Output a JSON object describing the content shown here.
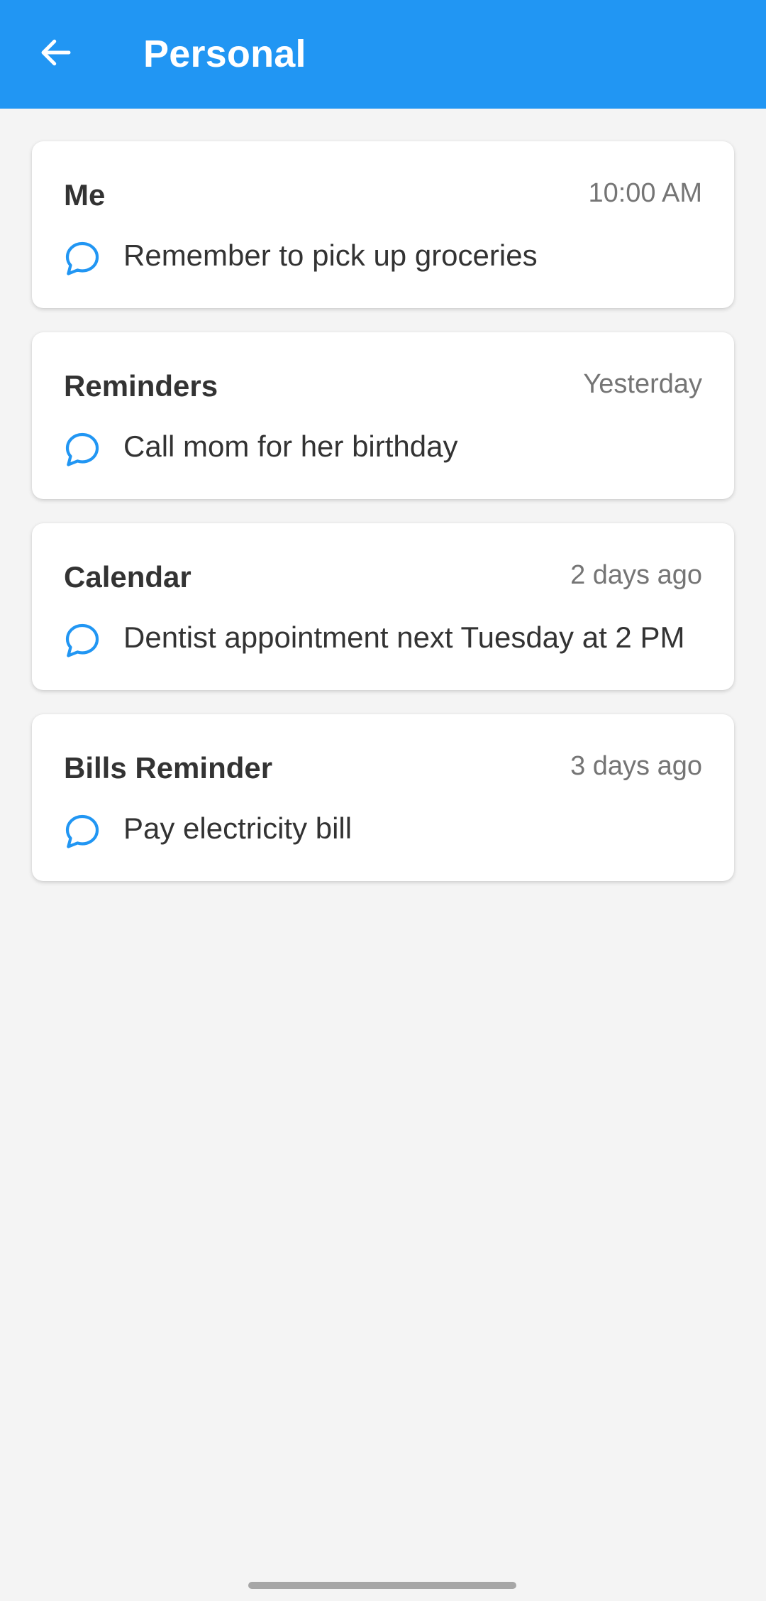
{
  "header": {
    "title": "Personal",
    "back_icon": "arrow-back-icon",
    "background_color": "#2196f3"
  },
  "items": [
    {
      "sender": "Me",
      "time": "10:00 AM",
      "message": "Remember to pick up groceries",
      "icon": "message-bubble-icon"
    },
    {
      "sender": "Reminders",
      "time": "Yesterday",
      "message": "Call mom for her birthday",
      "icon": "message-bubble-icon"
    },
    {
      "sender": "Calendar",
      "time": "2 days ago",
      "message": "Dentist appointment next Tuesday at 2 PM",
      "icon": "message-bubble-icon"
    },
    {
      "sender": "Bills Reminder",
      "time": "3 days ago",
      "message": "Pay electricity bill",
      "icon": "message-bubble-icon"
    }
  ],
  "colors": {
    "accent": "#2196f3",
    "background": "#f4f4f4",
    "card": "#ffffff",
    "text_primary": "#333333",
    "text_secondary": "#757575"
  }
}
